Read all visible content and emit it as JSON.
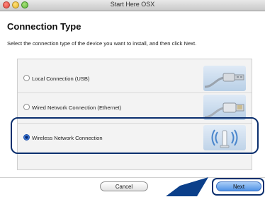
{
  "window": {
    "title": "Start Here OSX"
  },
  "page": {
    "heading": "Connection Type",
    "instruction": "Select the connection type of the device you want to install, and then click Next."
  },
  "options": [
    {
      "label": "Local Connection (USB)",
      "selected": false,
      "icon": "usb-cable-icon"
    },
    {
      "label": "Wired Network Connection (Ethernet)",
      "selected": false,
      "icon": "ethernet-cable-icon"
    },
    {
      "label": "Wireless Network Connection",
      "selected": true,
      "icon": "wireless-access-point-icon"
    }
  ],
  "buttons": {
    "cancel": "Cancel",
    "next": "Next"
  },
  "colors": {
    "highlight": "#0b2f6e",
    "next_button": "#4f92e6"
  }
}
